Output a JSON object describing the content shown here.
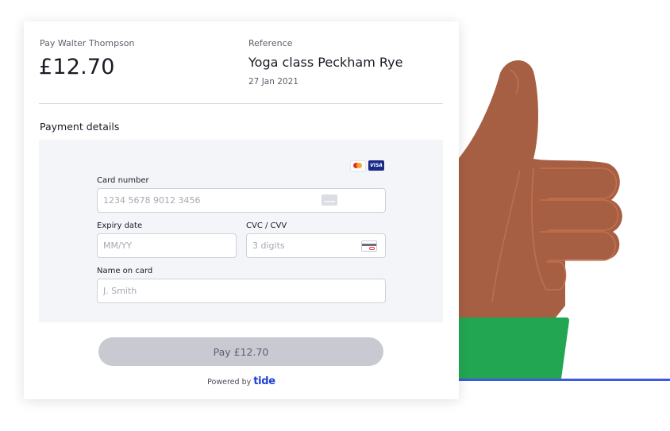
{
  "payment": {
    "payee_label": "Pay Walter Thompson",
    "amount": "£12.70",
    "reference_label": "Reference",
    "reference_value": "Yoga class Peckham Rye",
    "date": "27 Jan 2021"
  },
  "form": {
    "section_title": "Payment details",
    "visa_label": "VISA",
    "card_number": {
      "label": "Card number",
      "placeholder": "1234 5678 9012 3456",
      "value": ""
    },
    "expiry": {
      "label": "Expiry date",
      "placeholder": "MM/YY",
      "value": ""
    },
    "cvc": {
      "label": "CVC / CVV",
      "placeholder": "3 digits",
      "value": ""
    },
    "name": {
      "label": "Name on card",
      "placeholder": "J. Smith",
      "value": ""
    }
  },
  "actions": {
    "pay_label": "Pay £12.70"
  },
  "footer": {
    "powered_by": "Powered by",
    "brand": "tide"
  },
  "icons": [
    "mastercard-icon",
    "visa-icon",
    "card-icon",
    "cvc-card-icon",
    "thumbs-up-illustration"
  ],
  "colors": {
    "brand": "#1c3fd6",
    "button_disabled": "#c8c9d1",
    "hand": "#a65f43",
    "sleeve": "#22a651",
    "line": "#3d5ae0"
  }
}
